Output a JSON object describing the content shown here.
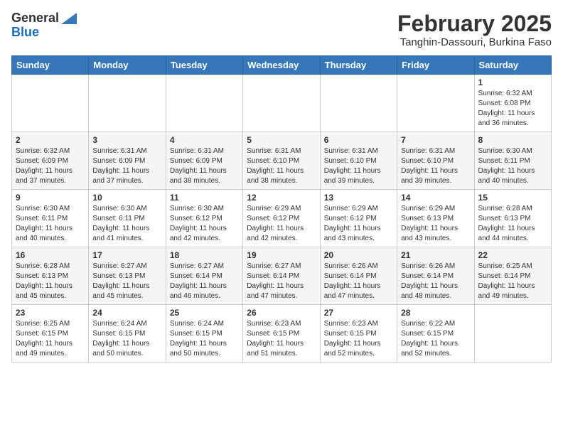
{
  "header": {
    "logo_general": "General",
    "logo_blue": "Blue",
    "month_title": "February 2025",
    "location": "Tanghin-Dassouri, Burkina Faso"
  },
  "days_of_week": [
    "Sunday",
    "Monday",
    "Tuesday",
    "Wednesday",
    "Thursday",
    "Friday",
    "Saturday"
  ],
  "weeks": [
    [
      {
        "day": "",
        "info": ""
      },
      {
        "day": "",
        "info": ""
      },
      {
        "day": "",
        "info": ""
      },
      {
        "day": "",
        "info": ""
      },
      {
        "day": "",
        "info": ""
      },
      {
        "day": "",
        "info": ""
      },
      {
        "day": "1",
        "info": "Sunrise: 6:32 AM\nSunset: 6:08 PM\nDaylight: 11 hours\nand 36 minutes."
      }
    ],
    [
      {
        "day": "2",
        "info": "Sunrise: 6:32 AM\nSunset: 6:09 PM\nDaylight: 11 hours\nand 37 minutes."
      },
      {
        "day": "3",
        "info": "Sunrise: 6:31 AM\nSunset: 6:09 PM\nDaylight: 11 hours\nand 37 minutes."
      },
      {
        "day": "4",
        "info": "Sunrise: 6:31 AM\nSunset: 6:09 PM\nDaylight: 11 hours\nand 38 minutes."
      },
      {
        "day": "5",
        "info": "Sunrise: 6:31 AM\nSunset: 6:10 PM\nDaylight: 11 hours\nand 38 minutes."
      },
      {
        "day": "6",
        "info": "Sunrise: 6:31 AM\nSunset: 6:10 PM\nDaylight: 11 hours\nand 39 minutes."
      },
      {
        "day": "7",
        "info": "Sunrise: 6:31 AM\nSunset: 6:10 PM\nDaylight: 11 hours\nand 39 minutes."
      },
      {
        "day": "8",
        "info": "Sunrise: 6:30 AM\nSunset: 6:11 PM\nDaylight: 11 hours\nand 40 minutes."
      }
    ],
    [
      {
        "day": "9",
        "info": "Sunrise: 6:30 AM\nSunset: 6:11 PM\nDaylight: 11 hours\nand 40 minutes."
      },
      {
        "day": "10",
        "info": "Sunrise: 6:30 AM\nSunset: 6:11 PM\nDaylight: 11 hours\nand 41 minutes."
      },
      {
        "day": "11",
        "info": "Sunrise: 6:30 AM\nSunset: 6:12 PM\nDaylight: 11 hours\nand 42 minutes."
      },
      {
        "day": "12",
        "info": "Sunrise: 6:29 AM\nSunset: 6:12 PM\nDaylight: 11 hours\nand 42 minutes."
      },
      {
        "day": "13",
        "info": "Sunrise: 6:29 AM\nSunset: 6:12 PM\nDaylight: 11 hours\nand 43 minutes."
      },
      {
        "day": "14",
        "info": "Sunrise: 6:29 AM\nSunset: 6:13 PM\nDaylight: 11 hours\nand 43 minutes."
      },
      {
        "day": "15",
        "info": "Sunrise: 6:28 AM\nSunset: 6:13 PM\nDaylight: 11 hours\nand 44 minutes."
      }
    ],
    [
      {
        "day": "16",
        "info": "Sunrise: 6:28 AM\nSunset: 6:13 PM\nDaylight: 11 hours\nand 45 minutes."
      },
      {
        "day": "17",
        "info": "Sunrise: 6:27 AM\nSunset: 6:13 PM\nDaylight: 11 hours\nand 45 minutes."
      },
      {
        "day": "18",
        "info": "Sunrise: 6:27 AM\nSunset: 6:14 PM\nDaylight: 11 hours\nand 46 minutes."
      },
      {
        "day": "19",
        "info": "Sunrise: 6:27 AM\nSunset: 6:14 PM\nDaylight: 11 hours\nand 47 minutes."
      },
      {
        "day": "20",
        "info": "Sunrise: 6:26 AM\nSunset: 6:14 PM\nDaylight: 11 hours\nand 47 minutes."
      },
      {
        "day": "21",
        "info": "Sunrise: 6:26 AM\nSunset: 6:14 PM\nDaylight: 11 hours\nand 48 minutes."
      },
      {
        "day": "22",
        "info": "Sunrise: 6:25 AM\nSunset: 6:14 PM\nDaylight: 11 hours\nand 49 minutes."
      }
    ],
    [
      {
        "day": "23",
        "info": "Sunrise: 6:25 AM\nSunset: 6:15 PM\nDaylight: 11 hours\nand 49 minutes."
      },
      {
        "day": "24",
        "info": "Sunrise: 6:24 AM\nSunset: 6:15 PM\nDaylight: 11 hours\nand 50 minutes."
      },
      {
        "day": "25",
        "info": "Sunrise: 6:24 AM\nSunset: 6:15 PM\nDaylight: 11 hours\nand 50 minutes."
      },
      {
        "day": "26",
        "info": "Sunrise: 6:23 AM\nSunset: 6:15 PM\nDaylight: 11 hours\nand 51 minutes."
      },
      {
        "day": "27",
        "info": "Sunrise: 6:23 AM\nSunset: 6:15 PM\nDaylight: 11 hours\nand 52 minutes."
      },
      {
        "day": "28",
        "info": "Sunrise: 6:22 AM\nSunset: 6:15 PM\nDaylight: 11 hours\nand 52 minutes."
      },
      {
        "day": "",
        "info": ""
      }
    ]
  ]
}
